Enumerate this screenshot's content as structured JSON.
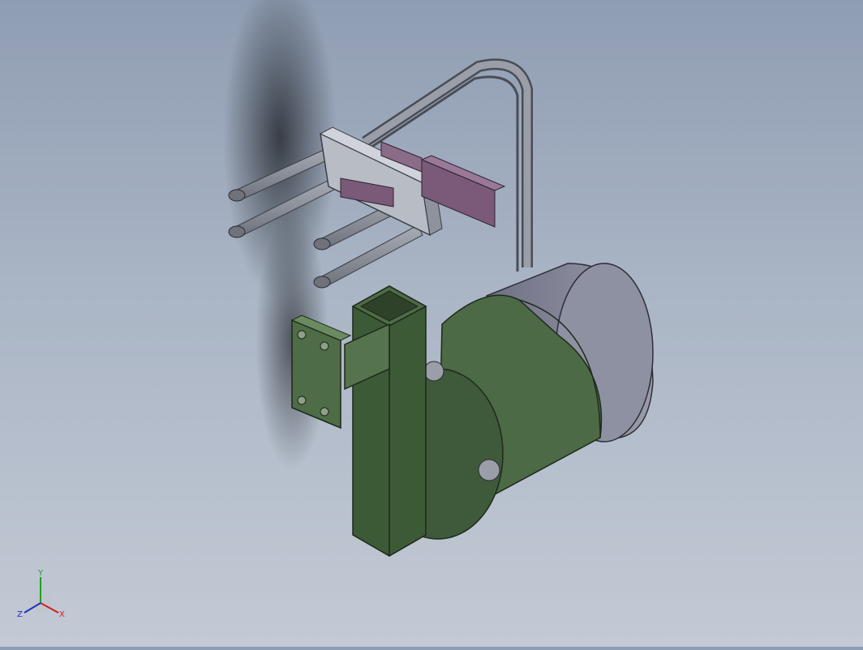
{
  "viewport": {
    "colors": {
      "background_top": "#8f9db3",
      "background_bottom": "#c3cad5",
      "frame_green": "#4f6b46",
      "frame_green_dark": "#34492f",
      "motor_gray": "#8a8d9f",
      "rod_gray": "#8b8f99",
      "cylinder_purple": "#7a5a78",
      "plate_light": "#b8bcc4"
    }
  },
  "triad": {
    "x_label": "X",
    "y_label": "Y",
    "z_label": "Z",
    "x_color": "#d02020",
    "y_color": "#20a020",
    "z_color": "#2030c0"
  }
}
